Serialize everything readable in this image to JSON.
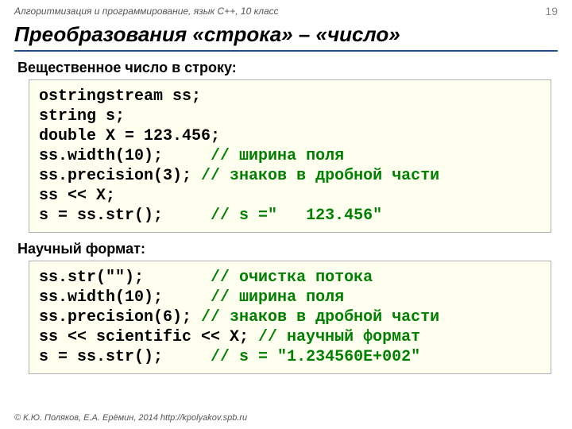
{
  "header": {
    "course": "Алгоритмизация и программирование, язык C++, 10 класс",
    "page": "19"
  },
  "title": "Преобразования «строка» – «число»",
  "section1": {
    "heading": "Вещественное число в строку:",
    "l1a": "ostringstream ",
    "l1b": "ss;",
    "l2a": "string ",
    "l2b": "s;",
    "l3a": "double ",
    "l3b": "X = 123.456;",
    "l4a": "ss.width(10);     ",
    "l4b": "// ширина поля",
    "l5a": "ss.precision(3); ",
    "l5b": "// знаков в дробной части",
    "l6": "ss << X;",
    "l7a": "s = ss.str();     ",
    "l7b": "// s =\"   123.456\""
  },
  "section2": {
    "heading": "Научный формат:",
    "l1a": "ss.str(\"\");       ",
    "l1b": "// очистка потока",
    "l2a": "ss.width(10);     ",
    "l2b": "// ширина поля",
    "l3a": "ss.precision(6); ",
    "l3b": "// знаков в дробной части",
    "l4a": "ss << scientific << X; ",
    "l4b": "// научный формат",
    "l5a": "s = ss.str();     ",
    "l5b": "// s = \"1.234560E+002\""
  },
  "footer": "© К.Ю. Поляков, Е.А. Ерёмин, 2014  http://kpolyakov.spb.ru"
}
